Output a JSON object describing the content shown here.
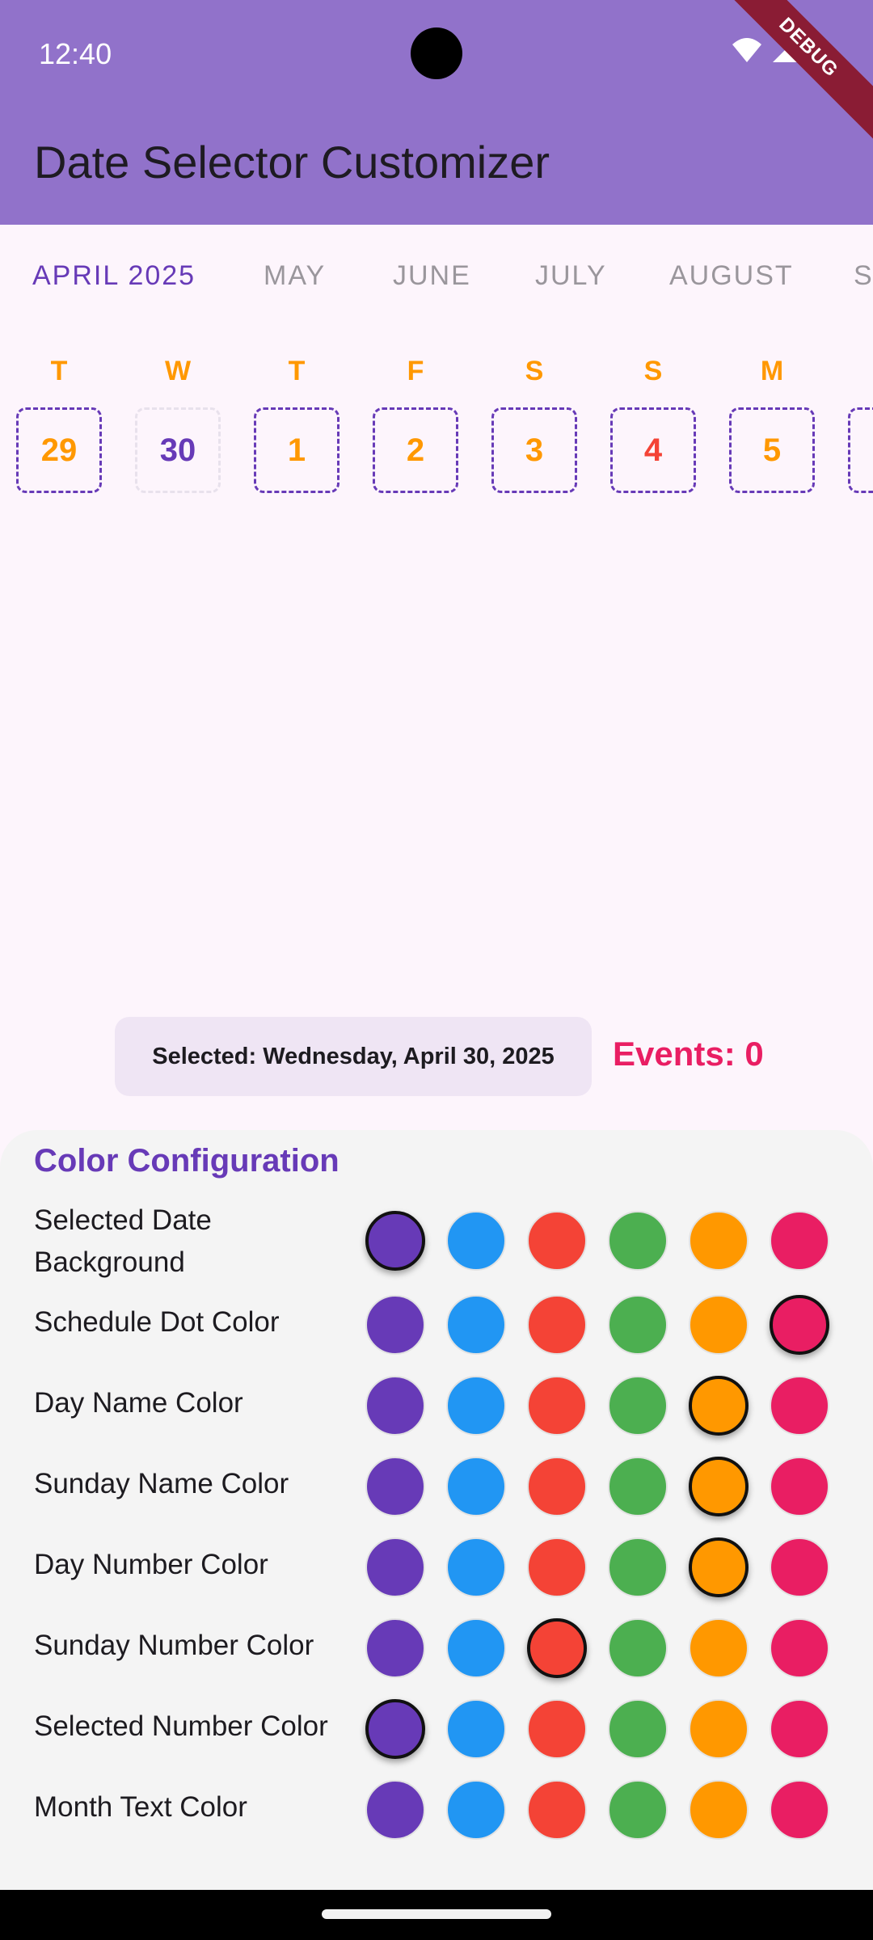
{
  "status_bar": {
    "time": "12:40"
  },
  "debug_banner": "DEBUG",
  "app_bar": {
    "title": "Date Selector Customizer"
  },
  "months": [
    "APRIL 2025",
    "MAY",
    "JUNE",
    "JULY",
    "AUGUST",
    "S"
  ],
  "active_month": "APRIL 2025",
  "days": [
    {
      "name": "T",
      "number": "29",
      "state": "normal"
    },
    {
      "name": "W",
      "number": "30",
      "state": "selected"
    },
    {
      "name": "T",
      "number": "1",
      "state": "normal"
    },
    {
      "name": "F",
      "number": "2",
      "state": "normal"
    },
    {
      "name": "S",
      "number": "3",
      "state": "normal"
    },
    {
      "name": "S",
      "number": "4",
      "state": "sunday"
    },
    {
      "name": "M",
      "number": "5",
      "state": "normal"
    }
  ],
  "selection": {
    "selected_text": "Selected: Wednesday, April 30, 2025",
    "events_text": "Events: 0"
  },
  "config": {
    "title": "Color Configuration",
    "palette": [
      "#673AB7",
      "#2196F3",
      "#F44336",
      "#4CAF50",
      "#FF9800",
      "#E91E63"
    ],
    "palette_names": [
      "purple",
      "blue",
      "red",
      "green",
      "orange",
      "pink"
    ],
    "rows": [
      {
        "label": "Selected Date Background",
        "selected": 0
      },
      {
        "label": "Schedule Dot Color",
        "selected": 5
      },
      {
        "label": "Day Name Color",
        "selected": 4
      },
      {
        "label": "Sunday Name Color",
        "selected": 4
      },
      {
        "label": "Day Number Color",
        "selected": 4
      },
      {
        "label": "Sunday Number Color",
        "selected": 2
      },
      {
        "label": "Selected Number Color",
        "selected": 0
      },
      {
        "label": "Month Text Color",
        "selected": null
      }
    ]
  }
}
